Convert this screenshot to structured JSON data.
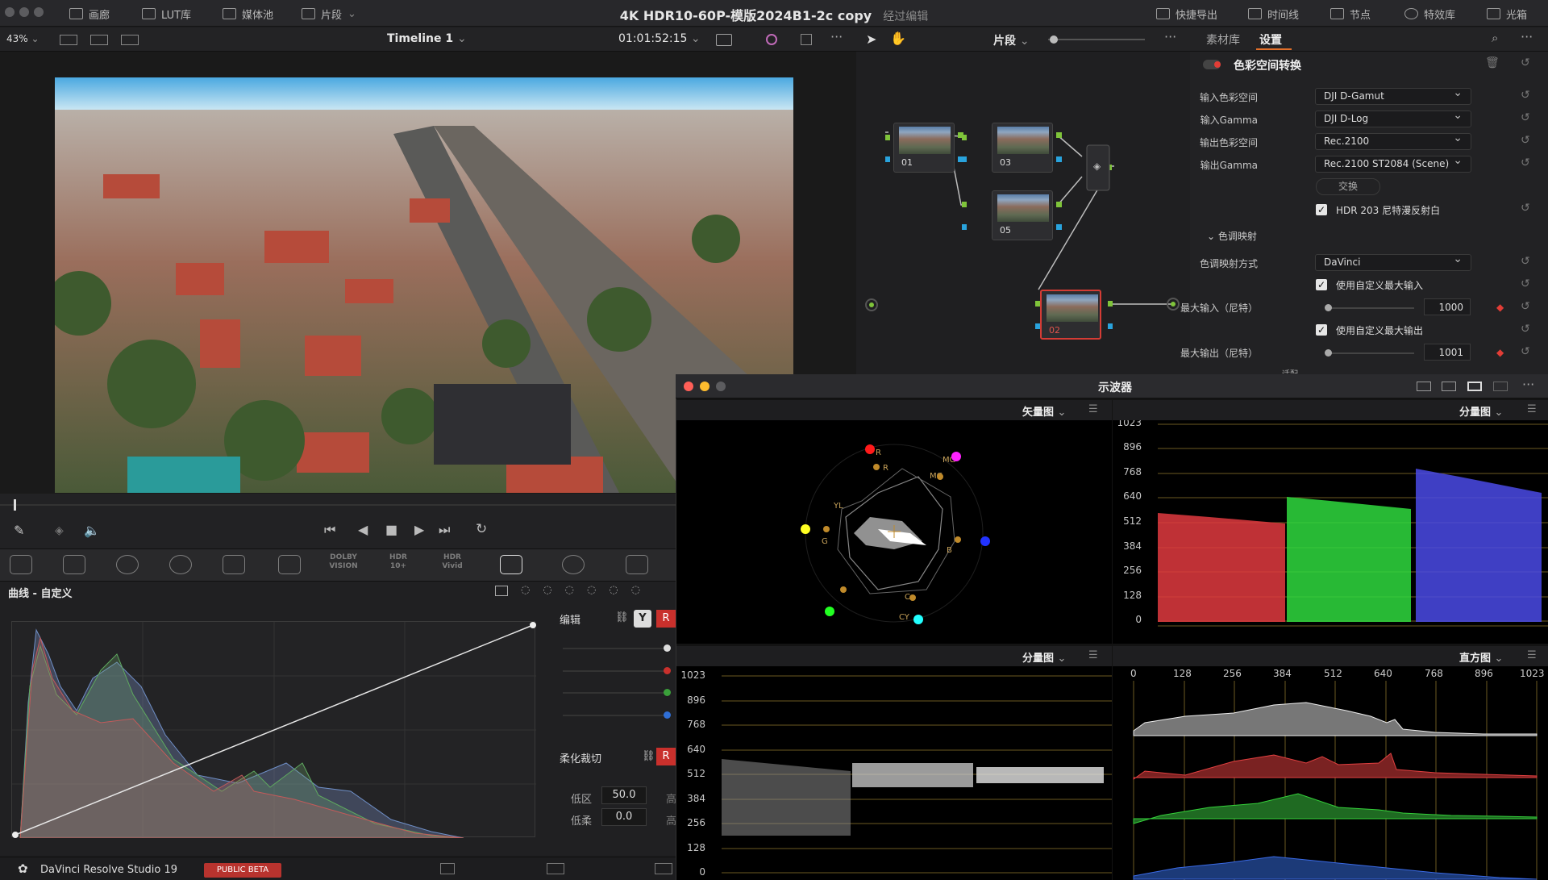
{
  "window": {
    "title": "4K HDR10-60P-模版2024B1-2c copy",
    "subtitle": "经过编辑"
  },
  "topbar": {
    "left": [
      "画廊",
      "LUT库",
      "媒体池",
      "片段"
    ],
    "right": [
      "快捷导出",
      "时间线",
      "节点",
      "特效库",
      "光箱"
    ]
  },
  "viewer": {
    "zoom": "43%",
    "timeline": "Timeline 1",
    "timecode": "01:01:52:15"
  },
  "nodes": {
    "mode": "片段",
    "items": [
      "01",
      "03",
      "05",
      "02"
    ]
  },
  "inspector": {
    "tabs": [
      "素材库",
      "设置"
    ],
    "effect": "色彩空间转换",
    "rows": [
      {
        "label": "输入色彩空间",
        "value": "DJI D-Gamut"
      },
      {
        "label": "输入Gamma",
        "value": "DJI D-Log"
      },
      {
        "label": "输出色彩空间",
        "value": "Rec.2100"
      },
      {
        "label": "输出Gamma",
        "value": "Rec.2100 ST2084 (Scene)"
      }
    ],
    "swap": "交换",
    "hdr203": "HDR 203 尼特漫反射白",
    "tone_section": "色调映射",
    "tone_label": "色调映射方式",
    "tone_value": "DaVinci",
    "custom_in": "使用自定义最大输入",
    "max_in_label": "最大输入（尼特）",
    "max_in": "1000",
    "custom_out": "使用自定义最大输出",
    "max_out_label": "最大输出（尼特）",
    "max_out": "1001",
    "cut_label": "适配"
  },
  "tools": {
    "dolby": "DOLBY VISION",
    "hdr10": "HDR 10+",
    "hdrvivid": "HDR Vivid"
  },
  "curves": {
    "title": "曲线 - 自定义",
    "edit": "编辑",
    "y": "Y",
    "r": "R",
    "soft": "柔化裁切",
    "low": "低区",
    "low_val": "50.0",
    "lowsoft": "低柔",
    "lowsoft_val": "0.0",
    "high": "高",
    "highsoft": "高"
  },
  "status": {
    "app": "DaVinci Resolve Studio 19",
    "beta": "PUBLIC BETA"
  },
  "scopes": {
    "title": "示波器",
    "vector": "矢量图",
    "parade": "分量图",
    "parade2": "分量图",
    "histogram": "直方图",
    "parade_ticks": [
      "1023",
      "896",
      "768",
      "640",
      "512",
      "384",
      "256",
      "128",
      "0"
    ],
    "hist_ticks": [
      "0",
      "128",
      "256",
      "384",
      "512",
      "640",
      "768",
      "896",
      "1023"
    ],
    "vector_labels": [
      "R",
      "MG",
      "R",
      "MG",
      "B",
      "YL",
      "C",
      "CY",
      "G"
    ]
  }
}
